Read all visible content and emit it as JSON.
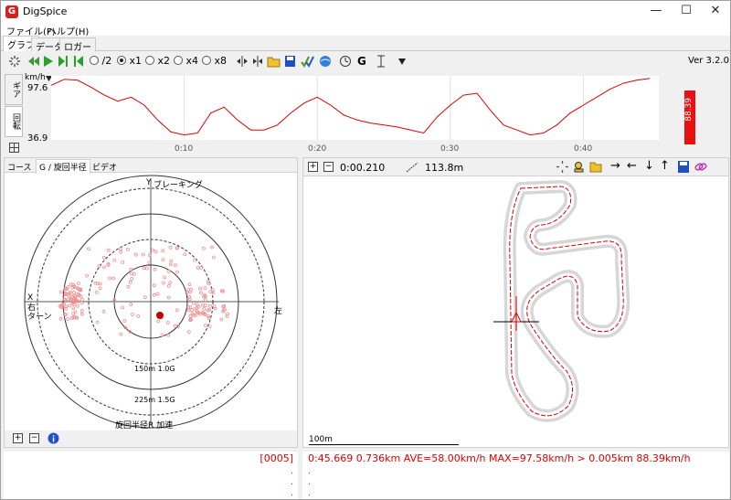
{
  "window": {
    "title": "DigSpice",
    "logo_letter": "G",
    "minimize": "—",
    "maximize": "☐",
    "close": "✕"
  },
  "menu": [
    {
      "label": "ファイル(F)"
    },
    {
      "label": "ヘルプ(H)"
    }
  ],
  "main_tabs": [
    {
      "label": "グラフ"
    },
    {
      "label": "データ"
    },
    {
      "label": "ロガー"
    }
  ],
  "toolbar": {
    "speed_options": [
      "/2",
      "x1",
      "x2",
      "x4",
      "x8"
    ],
    "selected_speed": "x1",
    "version": "Ver 3.2.0",
    "icons": [
      "loading-icon",
      "rewind-icon",
      "play-icon",
      "step-forward-icon",
      "step-back-icon",
      "expand-icon",
      "collapse-icon",
      "open-folder-icon",
      "save-icon",
      "check-icon",
      "globe-icon",
      "clock-icon",
      "g-icon",
      "vertical-cursor-icon",
      "dropdown-icon"
    ]
  },
  "speed_graph": {
    "unit": "km/h",
    "y_max_label": "97.6",
    "y_min_label": "36.9",
    "side_tabs": [
      "ギア",
      "回転"
    ],
    "x_ticks": [
      "0:10",
      "0:20",
      "0:30",
      "0:40"
    ],
    "bar_value": "88.39",
    "bar_color": "#e81010"
  },
  "chart_data": {
    "type": "line",
    "ylim": [
      36.9,
      97.6
    ],
    "xlim": [
      0,
      45.669
    ],
    "x": [
      0,
      1,
      2,
      3,
      4,
      5,
      6,
      7,
      8,
      9,
      10,
      11,
      12,
      13,
      14,
      15,
      16,
      17,
      18,
      19,
      20,
      21,
      22,
      23,
      24,
      25,
      26,
      27,
      28,
      29,
      30,
      31,
      32,
      33,
      34,
      35,
      36,
      37,
      38,
      39,
      40,
      41,
      42,
      43,
      44,
      45
    ],
    "series": [
      {
        "values": [
          90,
          96,
          95,
          88,
          80,
          74,
          78,
          70,
          55,
          43,
          40,
          42,
          62,
          68,
          55,
          45,
          45,
          50,
          62,
          72,
          78,
          70,
          60,
          55,
          52,
          50,
          48,
          45,
          42,
          58,
          70,
          80,
          82,
          65,
          50,
          45,
          40,
          42,
          50,
          62,
          70,
          78,
          86,
          92,
          95,
          97
        ]
      }
    ],
    "color": "#e00000"
  },
  "left_panel": {
    "tabs": [
      {
        "label": "コース"
      },
      {
        "label": "G / 旋回半径"
      },
      {
        "label": "ビデオ"
      }
    ],
    "active_tab": "G / 旋回半径",
    "labels": {
      "y_axis": "Y",
      "braking": "ブレーキング",
      "x_axis": "X",
      "right_turn": "右\nターン",
      "left": "左",
      "ring1": "150m  1.0G",
      "ring2": "225m  1.5G",
      "bottom": "旋回半径R 加速"
    }
  },
  "right_panel": {
    "time": "0:00.210",
    "distance": "113.8m",
    "scale_label": "100m",
    "icons": [
      "loading-icon",
      "person-search-icon",
      "open-folder-icon",
      "arrow-right-icon",
      "arrow-left-icon",
      "arrow-down-icon",
      "arrow-up-icon",
      "save-icon",
      "link-icon"
    ]
  },
  "status": {
    "left_text": "[0005]",
    "right_text": "0:45.669 0.736km AVE=58.00km/h MAX=97.58km/h > 0.005km 88.39km/h"
  }
}
